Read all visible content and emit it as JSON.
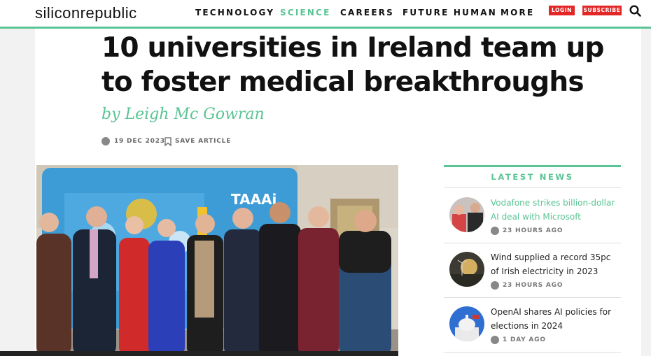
{
  "header": {
    "logo": "siliconrepublic",
    "nav": [
      "TECHNOLOGY",
      "SCIENCE",
      "CAREERS",
      "FUTURE HUMAN",
      "MORE"
    ],
    "active_nav": "SCIENCE",
    "login_label": "LOGIN",
    "subscribe_label": "SUBSCRIBE",
    "search_icon": "search-icon"
  },
  "article": {
    "headline_line1": "10 universities in Ireland team up",
    "headline_line2": "to foster medical breakthroughs",
    "byline": "by Leigh Mc Gowran",
    "date": "19 DEC 2023",
    "save_label": "SAVE ARTICLE",
    "banner_logo": "TAAAi"
  },
  "latest_news": {
    "heading": "LATEST NEWS",
    "items": [
      {
        "title": "Vodafone strikes billion-dollar AI deal with Microsoft",
        "time": "23 HOURS AGO"
      },
      {
        "title": "Wind supplied a record 35pc of Irish electricity in 2023",
        "time": "23 HOURS AGO"
      },
      {
        "title": "OpenAI shares AI policies for elections in 2024",
        "time": "1 DAY AGO"
      }
    ]
  },
  "colors": {
    "accent": "#59c494",
    "red_button": "#e32626"
  }
}
